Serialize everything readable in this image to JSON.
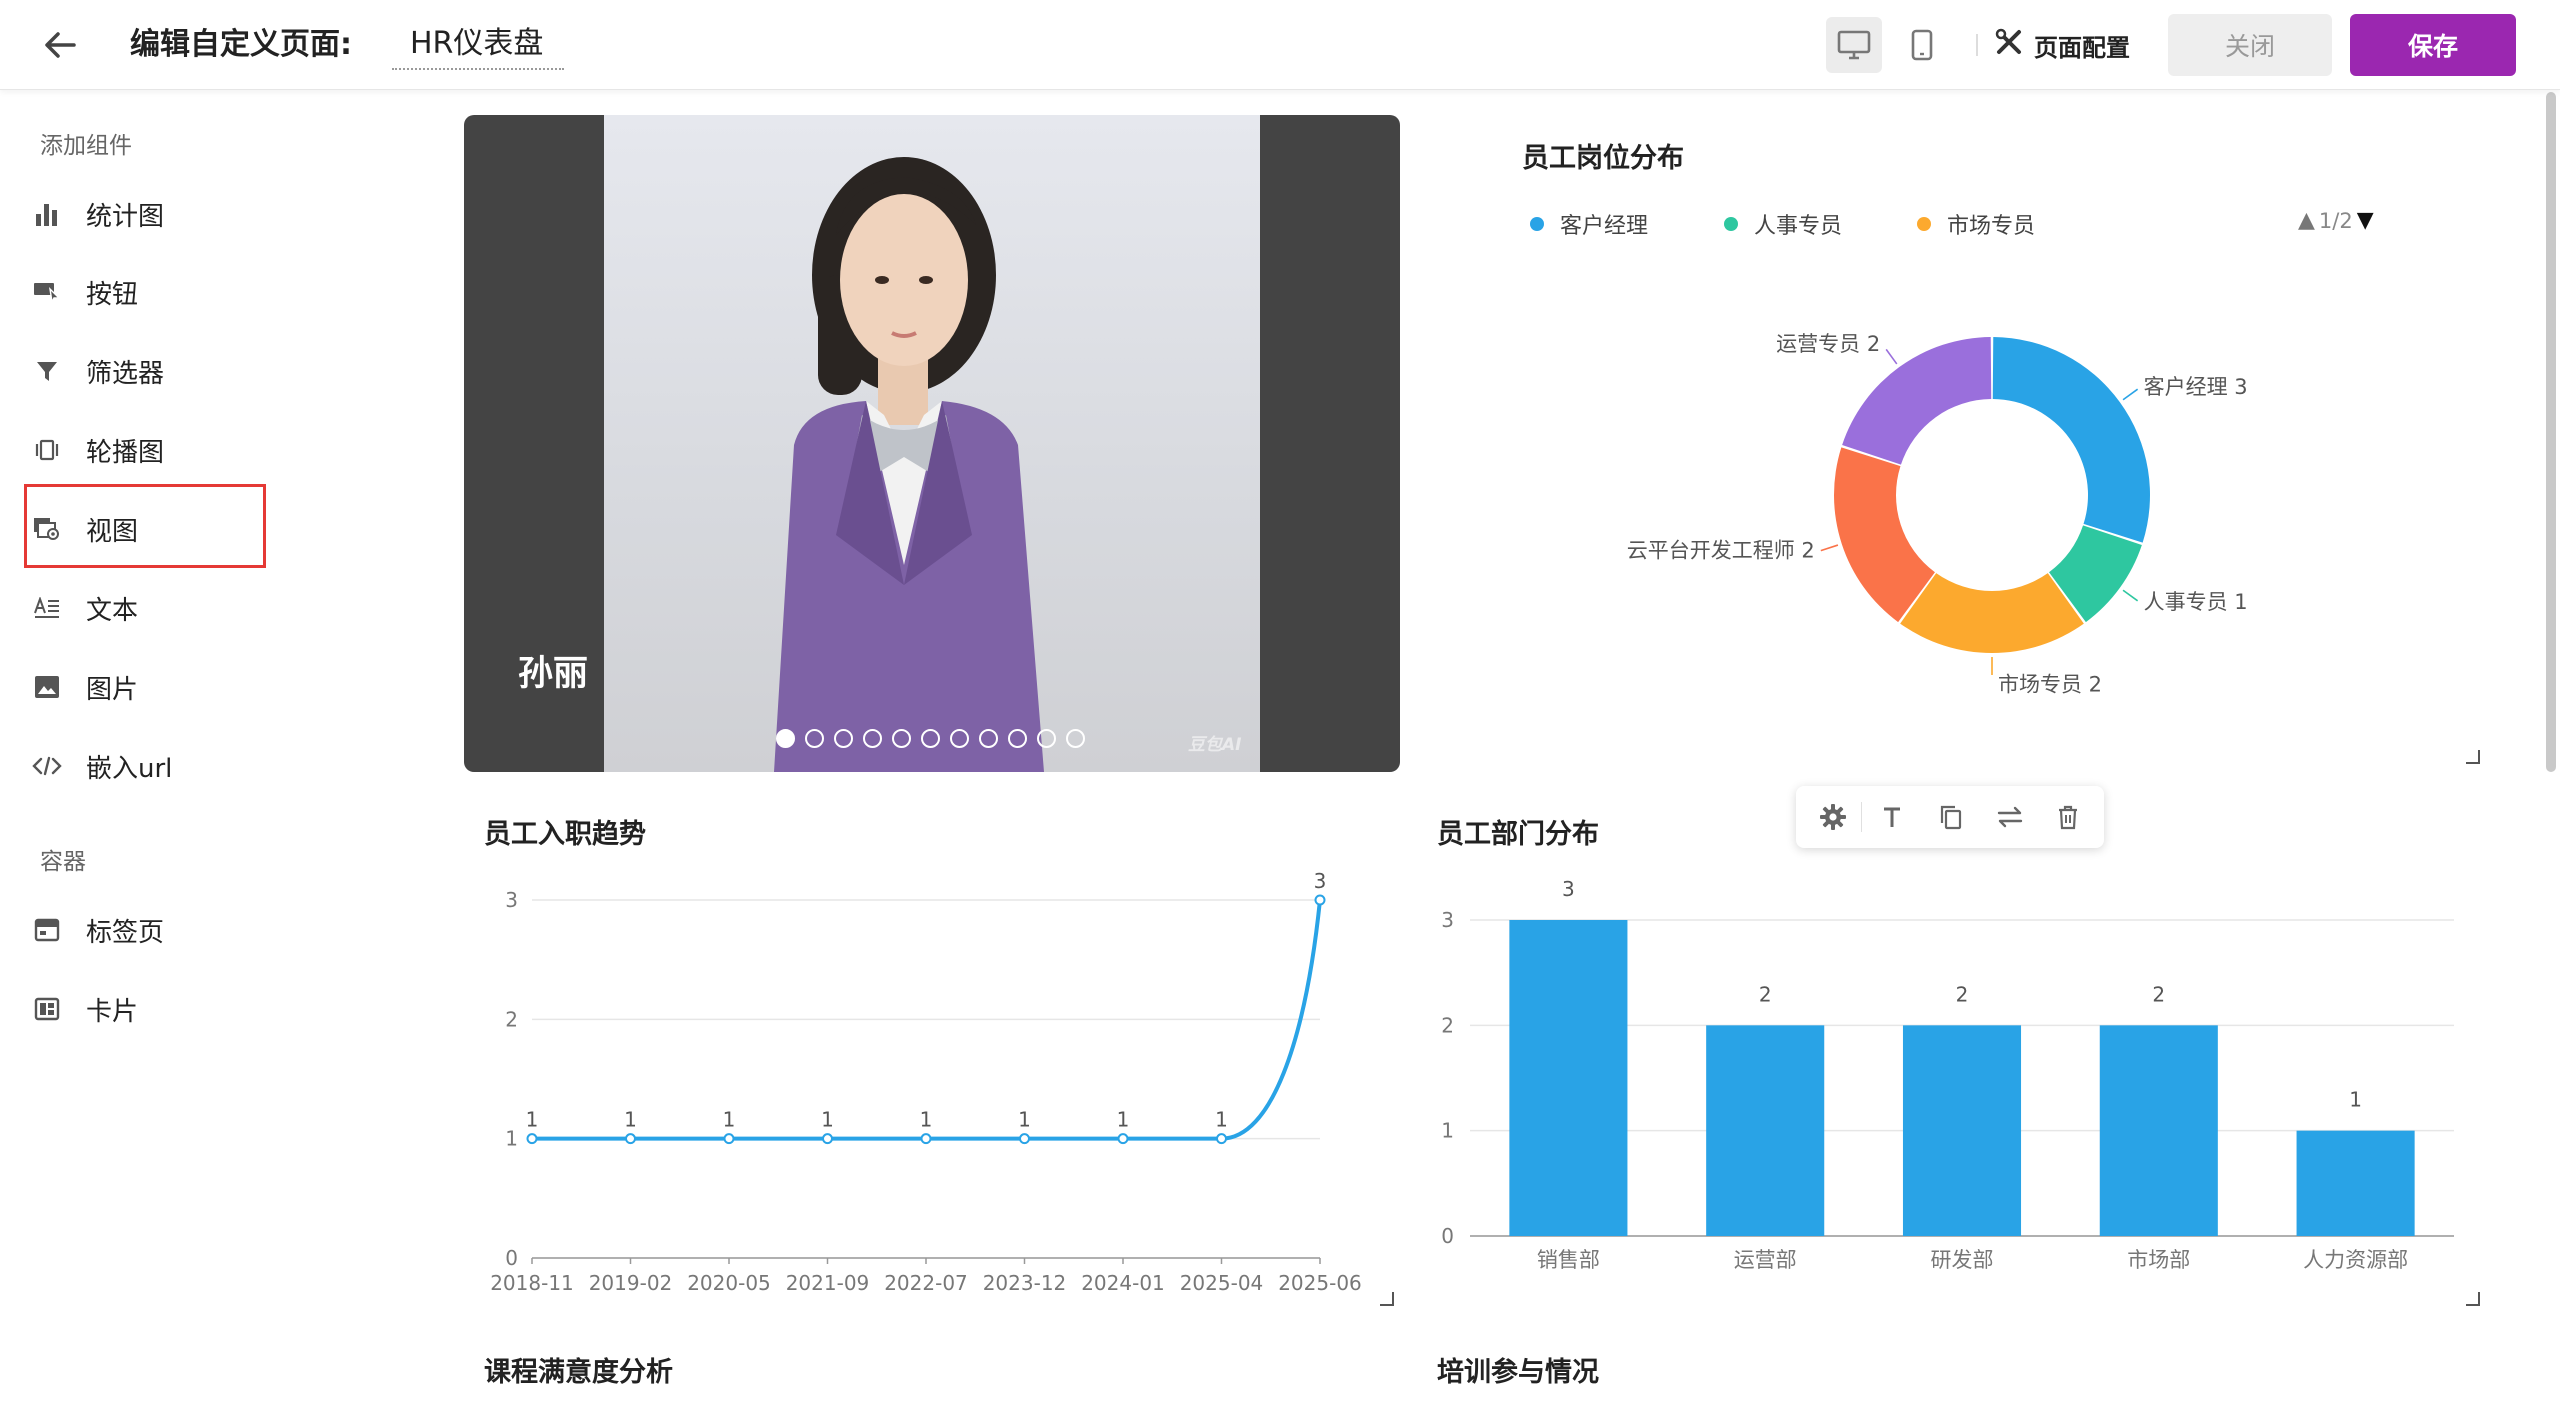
{
  "header": {
    "title": "编辑自定义页面:",
    "page_name": "HR仪表盘",
    "config_label": "页面配置",
    "close_label": "关闭",
    "save_label": "保存"
  },
  "sidebar": {
    "section_add": "添加组件",
    "items": [
      {
        "label": "统计图",
        "icon": "bar-chart-icon"
      },
      {
        "label": "按钮",
        "icon": "button-icon"
      },
      {
        "label": "筛选器",
        "icon": "filter-icon"
      },
      {
        "label": "轮播图",
        "icon": "carousel-icon"
      },
      {
        "label": "视图",
        "icon": "view-icon"
      },
      {
        "label": "文本",
        "icon": "text-icon"
      },
      {
        "label": "图片",
        "icon": "image-icon"
      },
      {
        "label": "嵌入url",
        "icon": "code-icon"
      }
    ],
    "section_container": "容器",
    "containers": [
      {
        "label": "标签页",
        "icon": "tab-icon"
      },
      {
        "label": "卡片",
        "icon": "card-icon"
      }
    ]
  },
  "carousel": {
    "caption": "孙丽",
    "watermark": "豆包AI",
    "slide_count": 11,
    "active_index": 0
  },
  "position_chart": {
    "title": "员工岗位分布",
    "legend": [
      "客户经理",
      "人事专员",
      "市场专员"
    ],
    "pager": "1/2"
  },
  "hire_chart": {
    "title": "员工入职趋势"
  },
  "dept_chart": {
    "title": "员工部门分布"
  },
  "bottom": {
    "course_title": "课程满意度分析",
    "training_title": "培训参与情况"
  },
  "colors": {
    "accent": "#9b27b0",
    "blue": "#29a3e6",
    "teal": "#2ec7a0",
    "orange": "#fca92e",
    "coral": "#fa7349",
    "purple": "#9a6fdc",
    "highlight": "#e53935"
  },
  "chart_data": [
    {
      "type": "pie",
      "title": "员工岗位分布",
      "categories": [
        "客户经理",
        "人事专员",
        "市场专员",
        "云平台开发工程师",
        "运营专员"
      ],
      "values": [
        3,
        1,
        2,
        2,
        2
      ],
      "colors": [
        "#29a3e6",
        "#2ec7a0",
        "#fca92e",
        "#fa7349",
        "#9a6fdc"
      ]
    },
    {
      "type": "line",
      "title": "员工入职趋势",
      "x": [
        "2018-11",
        "2019-02",
        "2020-05",
        "2021-09",
        "2022-07",
        "2023-12",
        "2024-01",
        "2025-04",
        "2025-06"
      ],
      "values": [
        1,
        1,
        1,
        1,
        1,
        1,
        1,
        1,
        3
      ],
      "ylim": [
        0,
        3
      ],
      "yticks": [
        0,
        1,
        2,
        3
      ],
      "grid": true
    },
    {
      "type": "bar",
      "title": "员工部门分布",
      "categories": [
        "销售部",
        "运营部",
        "研发部",
        "市场部",
        "人力资源部"
      ],
      "values": [
        3,
        2,
        2,
        2,
        1
      ],
      "ylim": [
        0,
        3
      ],
      "yticks": [
        0,
        1,
        2,
        3
      ],
      "grid": true
    }
  ]
}
